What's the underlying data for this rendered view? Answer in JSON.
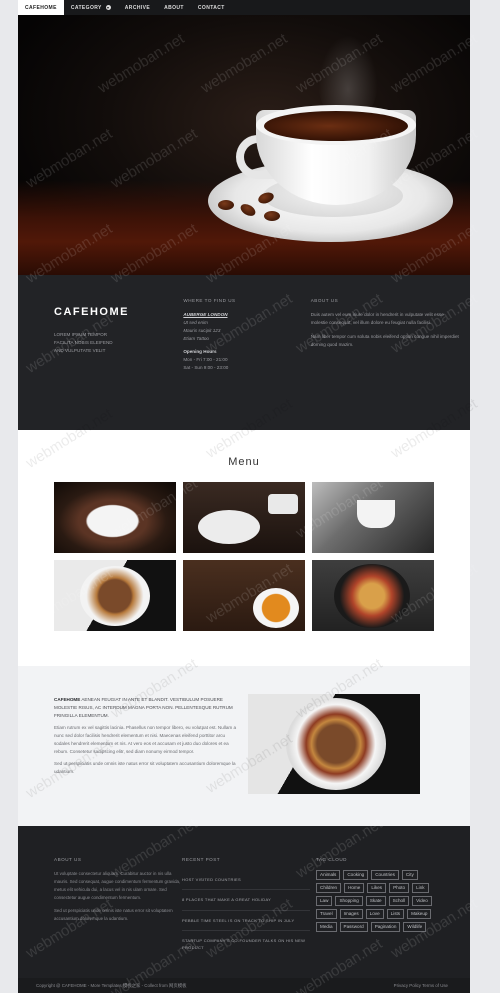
{
  "nav": {
    "items": [
      {
        "label": "CAFEHOME"
      },
      {
        "label": "CATEGORY"
      },
      {
        "label": "ARCHIVE"
      },
      {
        "label": "ABOUT"
      },
      {
        "label": "CONTACT"
      }
    ]
  },
  "info": {
    "brand": "CAFEHOME",
    "brand_lines": [
      "LOREM IPSUM TEMPOR",
      "FACILITA NOBIS ELEIFEND",
      "AND VULPUTATE VELIT"
    ],
    "where_heading": "WHERE TO FIND US",
    "address_title": "AUBERGE LONDON",
    "address_lines": [
      "Ut sed enim",
      "Mauris sucipit 123",
      "Etiam Tattoo"
    ],
    "hours_title": "Opening Hours",
    "hours_lines": [
      "Mon - Fri 7:00 - 21:00",
      "Sat - Sun 9:00 - 23:00"
    ],
    "about_heading": "ABOUT US",
    "about_p1": "Duis autem vel eum iriure dolor in hendrerit in vulputate velit esse molestie consequat, vel illum dolore eu feugiat nulla facilisi.",
    "about_p2": "Nam liber tempor cum soluta nobis eleifend option congue nihil imperdiet doming quod mazim."
  },
  "menu": {
    "title": "Menu"
  },
  "feature": {
    "lead_brand": "CAFEHOME",
    "lead": "AENEAN FEUGIAT IN ANTE ET BLANDIT. VESTIBULUM POSUERE MOLESTIE RISUS, AC INTERDUM MAGNA PORTA NON. PELLENTESQUE RUTRUM FRINGILLA ELEMENTUM.",
    "p1": "Etiam rutrum ex vel sagittis lacinia. Phasellus non tempor libero, eu volutpat est. Nullam a nunc sed dolor facilisis hendrerit elementum et nisi. Maecenas eleifend porttitor arcu sodales hendrerit elementum et nis. At vero eos et accusam et justo duo dolores et ea rebum. Consetetur sadipscing elitr, sed diam nonumy eirmod tempor.",
    "p2": "Sed ut perspiciatis unde omnis iste natus error sit voluptatem accusantium doloremque la udantium."
  },
  "footer": {
    "about_heading": "ABOUT US",
    "about_p1": "Ut voluptate consectetur aliquam. Curabitur auctor in nis ulla mauris. Sed consequat, augue condimentum fermentum gravida, metus elit vehicula dui, a lacus vel in nis ulam ornare. Sed consectetur augue condimentum fermentum.",
    "about_p2": "Sed ut perspiciatis unde omnis iste natus error sit voluptatem accusantium doloremque la udantium.",
    "recent_heading": "RECENT POST",
    "posts": [
      "HOST VISITED COUNTRIES",
      "8 PLACES THAT MAKE A GREAT HOLIDAY",
      "PEBBLE TIME STEEL IS ON TRACK TO SHIP IN JULY",
      "STARTUP COMPANY'S CO-FOUNDER TALKS ON HIS NEW PRODUCT"
    ],
    "tags_heading": "TAG CLOUD",
    "tags": [
      "Animals",
      "Cooking",
      "Countries",
      "City",
      "Children",
      "Home",
      "Likes",
      "Photo",
      "Link",
      "Law",
      "Shopping",
      "Skate",
      "Scholl",
      "Video",
      "Travel",
      "Images",
      "Love",
      "Lists",
      "Makeup",
      "Media",
      "Password",
      "Pagination",
      "Wildlife"
    ]
  },
  "copyright": {
    "left": "Copyright @ CAFEHOME - More Templates 模板之家 - Collect from 网页模板",
    "right": "Privacy Policy  Terms of Use"
  },
  "watermark": "webmoban.net"
}
